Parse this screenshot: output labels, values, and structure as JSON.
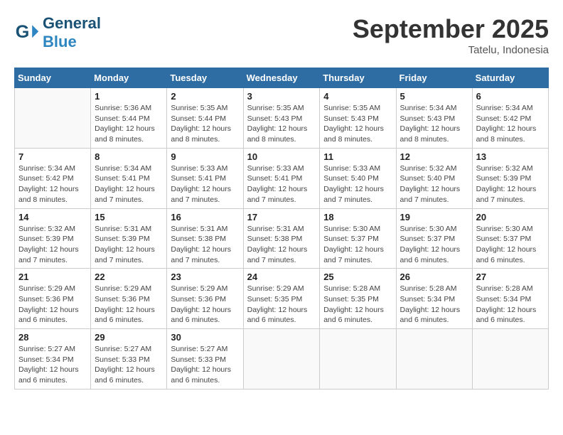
{
  "header": {
    "logo": {
      "general": "General",
      "blue": "Blue"
    },
    "title": "September 2025",
    "subtitle": "Tatelu, Indonesia"
  },
  "weekdays": [
    "Sunday",
    "Monday",
    "Tuesday",
    "Wednesday",
    "Thursday",
    "Friday",
    "Saturday"
  ],
  "weeks": [
    [
      {
        "day": "",
        "info": ""
      },
      {
        "day": "1",
        "info": "Sunrise: 5:36 AM\nSunset: 5:44 PM\nDaylight: 12 hours\nand 8 minutes."
      },
      {
        "day": "2",
        "info": "Sunrise: 5:35 AM\nSunset: 5:44 PM\nDaylight: 12 hours\nand 8 minutes."
      },
      {
        "day": "3",
        "info": "Sunrise: 5:35 AM\nSunset: 5:43 PM\nDaylight: 12 hours\nand 8 minutes."
      },
      {
        "day": "4",
        "info": "Sunrise: 5:35 AM\nSunset: 5:43 PM\nDaylight: 12 hours\nand 8 minutes."
      },
      {
        "day": "5",
        "info": "Sunrise: 5:34 AM\nSunset: 5:43 PM\nDaylight: 12 hours\nand 8 minutes."
      },
      {
        "day": "6",
        "info": "Sunrise: 5:34 AM\nSunset: 5:42 PM\nDaylight: 12 hours\nand 8 minutes."
      }
    ],
    [
      {
        "day": "7",
        "info": "Sunrise: 5:34 AM\nSunset: 5:42 PM\nDaylight: 12 hours\nand 8 minutes."
      },
      {
        "day": "8",
        "info": "Sunrise: 5:34 AM\nSunset: 5:41 PM\nDaylight: 12 hours\nand 7 minutes."
      },
      {
        "day": "9",
        "info": "Sunrise: 5:33 AM\nSunset: 5:41 PM\nDaylight: 12 hours\nand 7 minutes."
      },
      {
        "day": "10",
        "info": "Sunrise: 5:33 AM\nSunset: 5:41 PM\nDaylight: 12 hours\nand 7 minutes."
      },
      {
        "day": "11",
        "info": "Sunrise: 5:33 AM\nSunset: 5:40 PM\nDaylight: 12 hours\nand 7 minutes."
      },
      {
        "day": "12",
        "info": "Sunrise: 5:32 AM\nSunset: 5:40 PM\nDaylight: 12 hours\nand 7 minutes."
      },
      {
        "day": "13",
        "info": "Sunrise: 5:32 AM\nSunset: 5:39 PM\nDaylight: 12 hours\nand 7 minutes."
      }
    ],
    [
      {
        "day": "14",
        "info": "Sunrise: 5:32 AM\nSunset: 5:39 PM\nDaylight: 12 hours\nand 7 minutes."
      },
      {
        "day": "15",
        "info": "Sunrise: 5:31 AM\nSunset: 5:39 PM\nDaylight: 12 hours\nand 7 minutes."
      },
      {
        "day": "16",
        "info": "Sunrise: 5:31 AM\nSunset: 5:38 PM\nDaylight: 12 hours\nand 7 minutes."
      },
      {
        "day": "17",
        "info": "Sunrise: 5:31 AM\nSunset: 5:38 PM\nDaylight: 12 hours\nand 7 minutes."
      },
      {
        "day": "18",
        "info": "Sunrise: 5:30 AM\nSunset: 5:37 PM\nDaylight: 12 hours\nand 7 minutes."
      },
      {
        "day": "19",
        "info": "Sunrise: 5:30 AM\nSunset: 5:37 PM\nDaylight: 12 hours\nand 6 minutes."
      },
      {
        "day": "20",
        "info": "Sunrise: 5:30 AM\nSunset: 5:37 PM\nDaylight: 12 hours\nand 6 minutes."
      }
    ],
    [
      {
        "day": "21",
        "info": "Sunrise: 5:29 AM\nSunset: 5:36 PM\nDaylight: 12 hours\nand 6 minutes."
      },
      {
        "day": "22",
        "info": "Sunrise: 5:29 AM\nSunset: 5:36 PM\nDaylight: 12 hours\nand 6 minutes."
      },
      {
        "day": "23",
        "info": "Sunrise: 5:29 AM\nSunset: 5:36 PM\nDaylight: 12 hours\nand 6 minutes."
      },
      {
        "day": "24",
        "info": "Sunrise: 5:29 AM\nSunset: 5:35 PM\nDaylight: 12 hours\nand 6 minutes."
      },
      {
        "day": "25",
        "info": "Sunrise: 5:28 AM\nSunset: 5:35 PM\nDaylight: 12 hours\nand 6 minutes."
      },
      {
        "day": "26",
        "info": "Sunrise: 5:28 AM\nSunset: 5:34 PM\nDaylight: 12 hours\nand 6 minutes."
      },
      {
        "day": "27",
        "info": "Sunrise: 5:28 AM\nSunset: 5:34 PM\nDaylight: 12 hours\nand 6 minutes."
      }
    ],
    [
      {
        "day": "28",
        "info": "Sunrise: 5:27 AM\nSunset: 5:34 PM\nDaylight: 12 hours\nand 6 minutes."
      },
      {
        "day": "29",
        "info": "Sunrise: 5:27 AM\nSunset: 5:33 PM\nDaylight: 12 hours\nand 6 minutes."
      },
      {
        "day": "30",
        "info": "Sunrise: 5:27 AM\nSunset: 5:33 PM\nDaylight: 12 hours\nand 6 minutes."
      },
      {
        "day": "",
        "info": ""
      },
      {
        "day": "",
        "info": ""
      },
      {
        "day": "",
        "info": ""
      },
      {
        "day": "",
        "info": ""
      }
    ]
  ]
}
